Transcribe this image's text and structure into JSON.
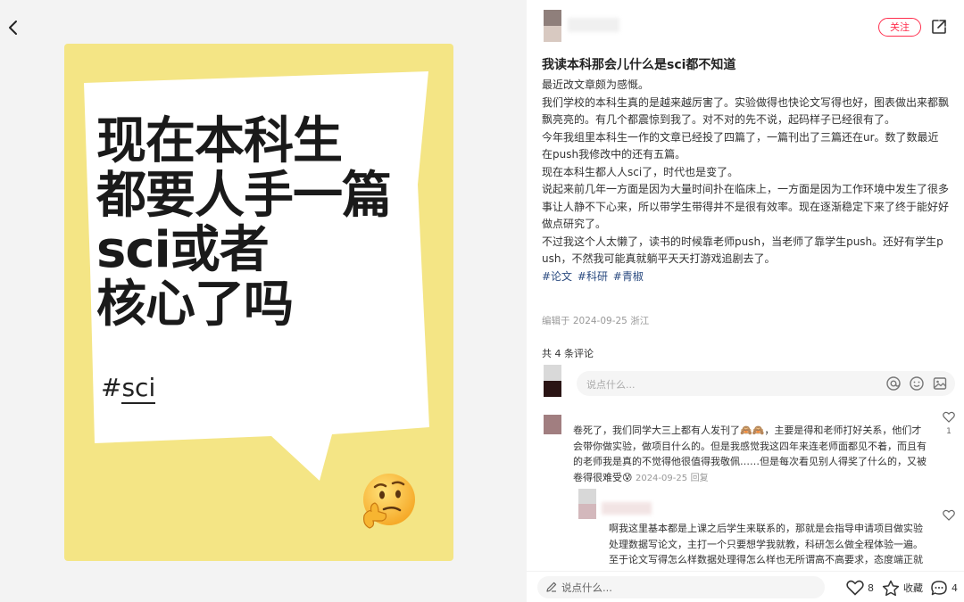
{
  "poster": {
    "headline_lines": [
      "现在本科生",
      "都要人手一篇",
      "sci或者",
      "核心了吗"
    ],
    "hashtag_prefix": "#",
    "hashtag_word": "sci",
    "emoji": "thinking-face"
  },
  "header": {
    "follow_label": "关注",
    "share_icon": "share-icon"
  },
  "post": {
    "title": "我读本科那会儿什么是sci都不知道",
    "paragraphs": [
      "最近改文章颇为感慨。",
      "我们学校的本科生真的是越来越厉害了。实验做得也快论文写得也好，图表做出来都飘飘亮亮的。有几个都震惊到我了。对不对的先不说，起码样子已经很有了。",
      "今年我组里本科生一作的文章已经投了四篇了，一篇刊出了三篇还在ur。数了数最近在push我修改中的还有五篇。",
      "现在本科生都人人sci了，时代也是变了。",
      "说起来前几年一方面是因为大量时间扑在临床上，一方面是因为工作环境中发生了很多事让人静不下心来，所以带学生带得并不是很有效率。现在逐渐稳定下来了终于能好好做点研究了。",
      "不过我这个人太懒了，读书的时候靠老师push，当老师了靠学生push。还好有学生push，不然我可能真就躺平天天打游戏追剧去了。"
    ],
    "tags": [
      "#论文",
      "#科研",
      "#青椒"
    ],
    "edit_meta": "编辑于 2024-09-25 浙江"
  },
  "comments": {
    "count_label": "共 4 条评论",
    "input_placeholder": "说点什么...",
    "items": [
      {
        "text": "卷死了，我们同学大三上都有人发刊了🙈🙈，主要是得和老师打好关系，他们才会带你做实验，做项目什么的。但是我感觉我这四年来连老师面都见不着，而且有的老师我是真的不觉得他很值得我敬佩……但是每次看见别人得奖了什么的，又被卷得很难受😰",
        "date": "2024-09-25",
        "reply": "回复",
        "likes": "1"
      },
      {
        "text": "啊我这里基本都是上课之后学生来联系的，那就是会指导申请项目做实验处理数据写论文，主打一个只要想学我就教，科研怎么做全程体验一遍。至于论文写得怎么样数据处理得怎么样也无所谓高不高要求，态度端正就好，约约会 … 签名 🌱",
        "likes": ""
      }
    ]
  },
  "bottom_bar": {
    "input_placeholder": "说点什么...",
    "likes": "8",
    "collect_label": "收藏",
    "comments": "4"
  },
  "colors": {
    "accent": "#ff2e4d",
    "poster_bg": "#f4e585",
    "tag": "#2b4b80"
  }
}
